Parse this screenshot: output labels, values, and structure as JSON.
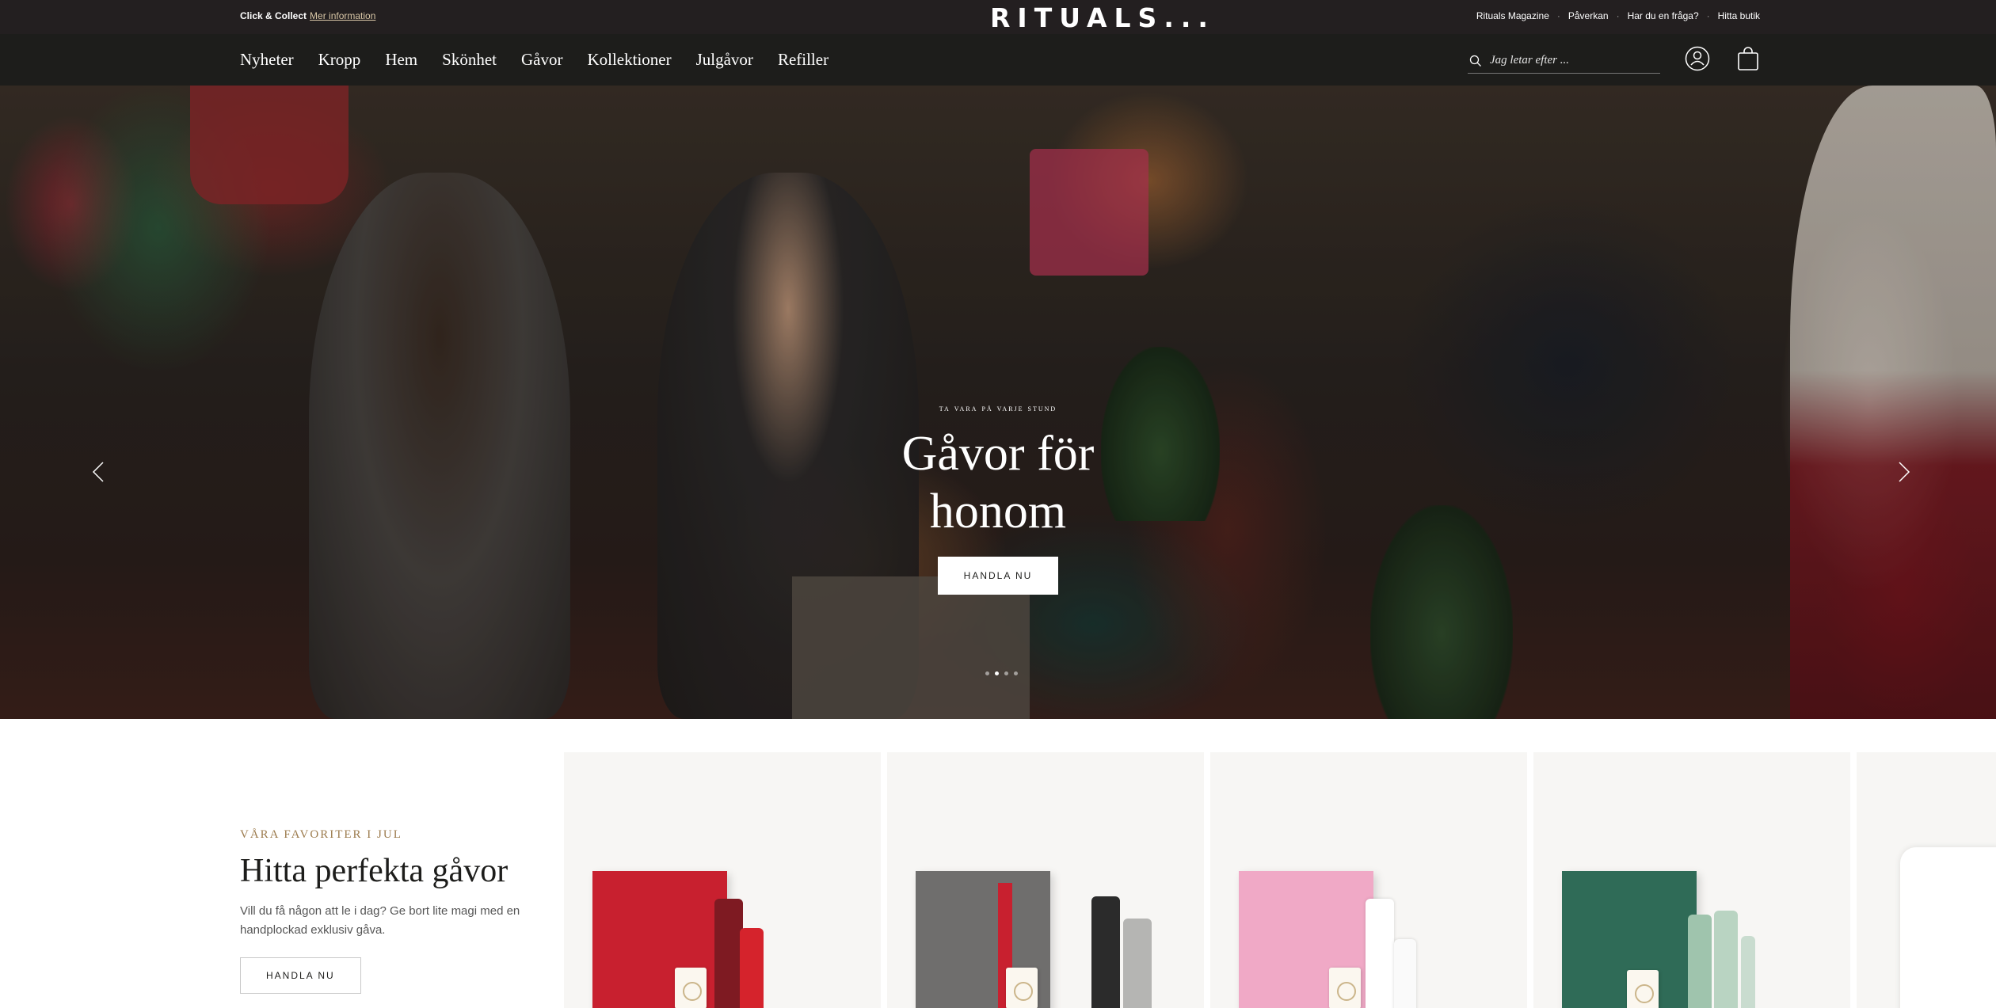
{
  "topbar": {
    "click_collect": "Click & Collect",
    "more_info": "Mer information",
    "logo": "RITUALS...",
    "links": [
      "Rituals Magazine",
      "Påverkan",
      "Har du en fråga?",
      "Hitta butik"
    ]
  },
  "nav": {
    "items": [
      "Nyheter",
      "Kropp",
      "Hem",
      "Skönhet",
      "Gåvor",
      "Kollektioner",
      "Julgåvor",
      "Refiller"
    ],
    "search_placeholder": "Jag letar efter ...",
    "account_icon": "user-icon",
    "bag_icon": "shopping-bag-icon"
  },
  "hero": {
    "eyebrow": "TA VARA PÅ VARJE STUND",
    "title_line1": "Gåvor för",
    "title_line2": "honom",
    "cta": "HANDLA NU",
    "slides": 4,
    "active_slide": 2
  },
  "favorites": {
    "eyebrow": "VÅRA FAVORITER I JUL",
    "title": "Hitta perfekta gåvor",
    "description": "Vill du få någon att le i dag? Ge bort lite magi med en handplockad exklusiv gåva.",
    "cta": "HANDLA NU",
    "products": [
      {
        "name": "red-gift-set",
        "box_color": "#c8202f",
        "bottle_color": "#7e1a22"
      },
      {
        "name": "grey-gift-set",
        "box_color": "#6f6e6d",
        "bottle_color": "#2b2b2b"
      },
      {
        "name": "pink-gift-set",
        "box_color": "#f0a9c6",
        "bottle_color": "#ffffff"
      },
      {
        "name": "green-gift-set",
        "box_color": "#2f6b57",
        "bottle_color": "#9fc4ad"
      }
    ]
  }
}
